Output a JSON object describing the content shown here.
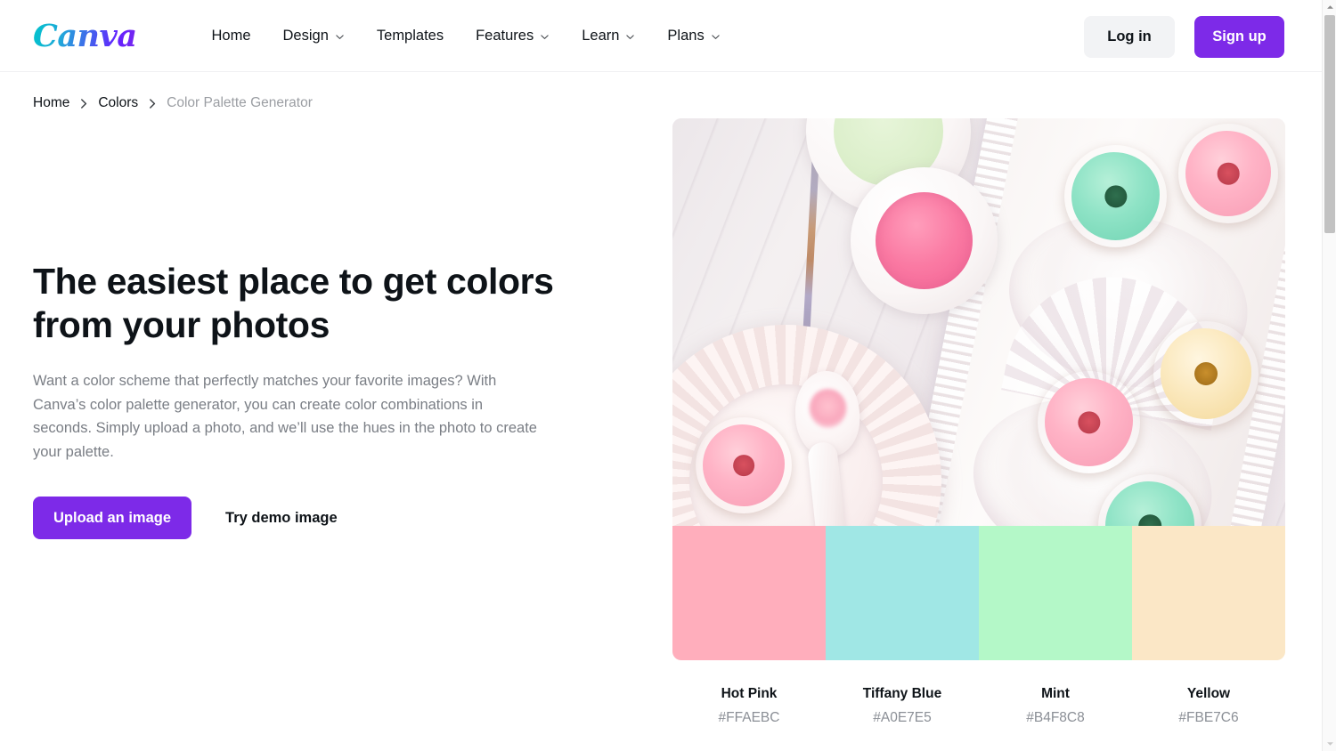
{
  "header": {
    "logo_text": "Canva",
    "nav": [
      {
        "label": "Home",
        "has_dropdown": false
      },
      {
        "label": "Design",
        "has_dropdown": true
      },
      {
        "label": "Templates",
        "has_dropdown": false
      },
      {
        "label": "Features",
        "has_dropdown": true
      },
      {
        "label": "Learn",
        "has_dropdown": true
      },
      {
        "label": "Plans",
        "has_dropdown": true
      }
    ],
    "login_label": "Log in",
    "signup_label": "Sign up"
  },
  "breadcrumb": {
    "items": [
      {
        "label": "Home"
      },
      {
        "label": "Colors"
      },
      {
        "label": "Color Palette Generator"
      }
    ]
  },
  "hero": {
    "title": "The easiest place to get colors from your photos",
    "description": "Want a color scheme that perfectly matches your favorite images? With Canva’s color palette generator, you can create color combinations in seconds. Simply upload a photo, and we’ll use the hues in the photo to create your palette.",
    "upload_label": "Upload an image",
    "demo_label": "Try demo image"
  },
  "palette": {
    "swatches": [
      {
        "name": "Hot Pink",
        "hex": "#FFAEBC"
      },
      {
        "name": "Tiffany Blue",
        "hex": "#A0E7E5"
      },
      {
        "name": "Mint",
        "hex": "#B4F8C8"
      },
      {
        "name": "Yellow",
        "hex": "#FBE7C6"
      }
    ]
  },
  "theme": {
    "brand_purple": "#7D2AE8",
    "logo_gradient_start": "#00C4CC",
    "logo_gradient_end": "#7D2AE8",
    "text_dark": "#0E1318",
    "text_muted": "#7A7E85"
  },
  "icons": {
    "chevron_down": "chevron-down-icon",
    "breadcrumb_separator": "chevron-right-icon",
    "scroll_up": "scroll-up-arrow-icon",
    "scroll_down": "scroll-down-arrow-icon"
  }
}
